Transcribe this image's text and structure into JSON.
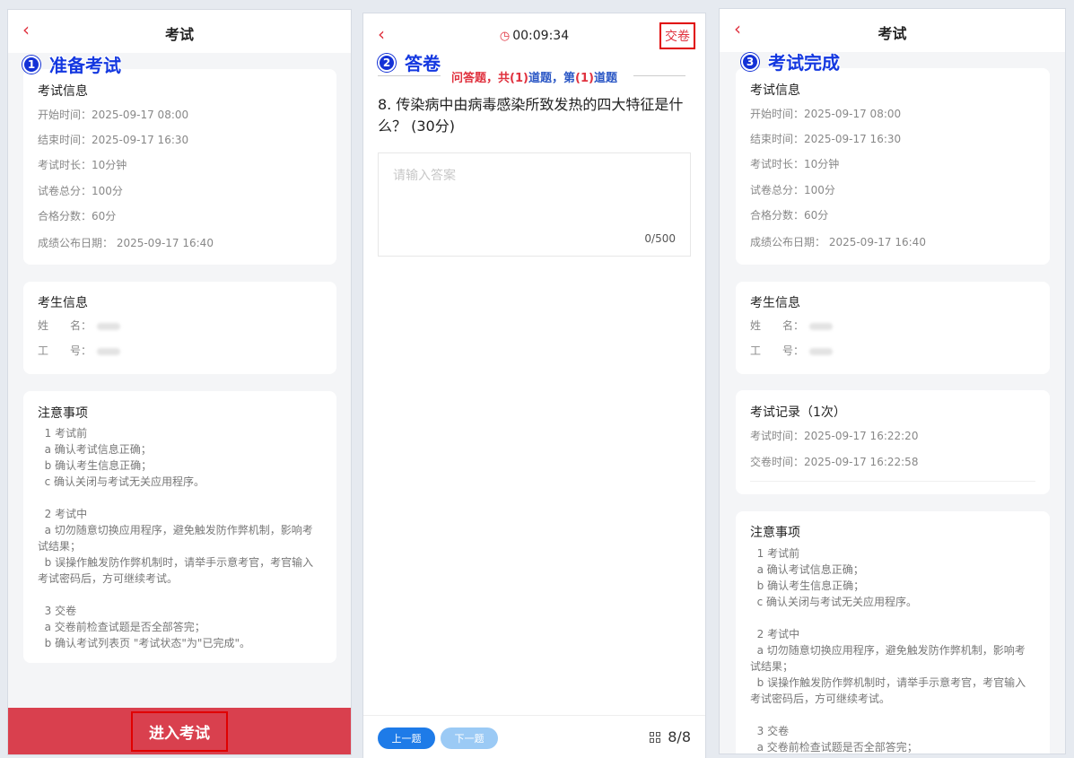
{
  "steps": {
    "s1": {
      "num": "1",
      "label": "准备考试"
    },
    "s2": {
      "num": "2",
      "label": "答卷"
    },
    "s3": {
      "num": "3",
      "label": "考试完成"
    }
  },
  "exam": {
    "title": "考试",
    "back_icon": "chevron-left-icon",
    "info_title": "考试信息",
    "start": "开始时间：2025-09-17 08:00",
    "end": "结束时间：2025-09-17 16:30",
    "duration": "考试时长：10分钟",
    "total": "试卷总分：100分",
    "pass": "合格分数：60分",
    "publish": "成绩公布日期：  2025-09-17 16:40",
    "candidate_title": "考生信息",
    "name_label": "姓　　名：",
    "id_label": "工　　号：",
    "notes_title": "注意事项",
    "notes": [
      "  1 考试前",
      "  a 确认考试信息正确；",
      "  b 确认考生信息正确；",
      "  c 确认关闭与考试无关应用程序。",
      " ",
      "  2 考试中",
      "  a 切勿随意切换应用程序，避免触发防作弊机制，影响考试结果；",
      "  b 误操作触发防作弊机制时，请举手示意考官，考官输入考试密码后，方可继续考试。",
      " ",
      "  3 交卷",
      "  a 交卷前检查试题是否全部答完；",
      "  b 确认考试列表页 \"考试状态\"为\"已完成\"。"
    ],
    "enter_button": "进入考试"
  },
  "answering": {
    "timer_icon": "clock-icon",
    "timer": "00:09:34",
    "submit": "交卷",
    "qtype_a": "问答题，共",
    "qtype_b": "(1)",
    "qtype_c": "道题，第",
    "qtype_d": "(1)",
    "qtype_e": "道题",
    "question": "8. 传染病中由病毒感染所致发热的四大特征是什么？ (30分)",
    "answer_placeholder": "请输入答案",
    "answer_value": "",
    "char_count": "0/500",
    "prev": "上一题",
    "next": "下一题",
    "progress": "8/8",
    "grid_icon": "grid-icon",
    "accent": "#1e7be8",
    "accent_light": "#9bcaf5"
  },
  "done": {
    "record_title": "考试记录（1次）",
    "exam_time": "考试时间：2025-09-17 16:22:20",
    "submit_time": "交卷时间：2025-09-17 16:22:58",
    "notes_partial": "  a 交卷前检查试题是否全部答完；"
  }
}
